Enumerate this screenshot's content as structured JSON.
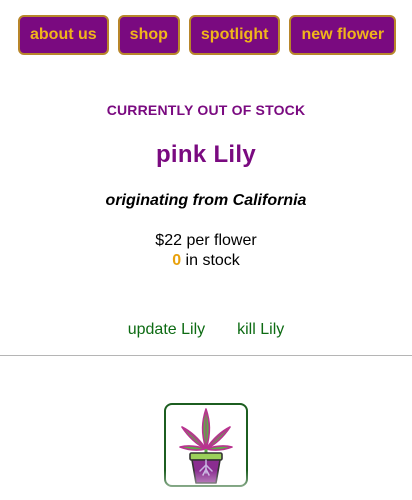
{
  "nav": {
    "items": [
      {
        "label": "about us"
      },
      {
        "label": "shop"
      },
      {
        "label": "spotlight"
      },
      {
        "label": "new flower"
      }
    ]
  },
  "product": {
    "status": "CURRENTLY OUT OF STOCK",
    "name": "pink Lily",
    "origin": "originating from California",
    "price": "$22 per flower",
    "stock_count": "0",
    "stock_suffix": " in stock"
  },
  "actions": {
    "update_label": "update Lily",
    "kill_label": "kill Lily"
  },
  "image": {
    "icon": "potted-plant-icon"
  },
  "colors": {
    "brand_purple": "#7a0a80",
    "accent_gold": "#f0b51a",
    "link_green": "#0d6b13"
  }
}
